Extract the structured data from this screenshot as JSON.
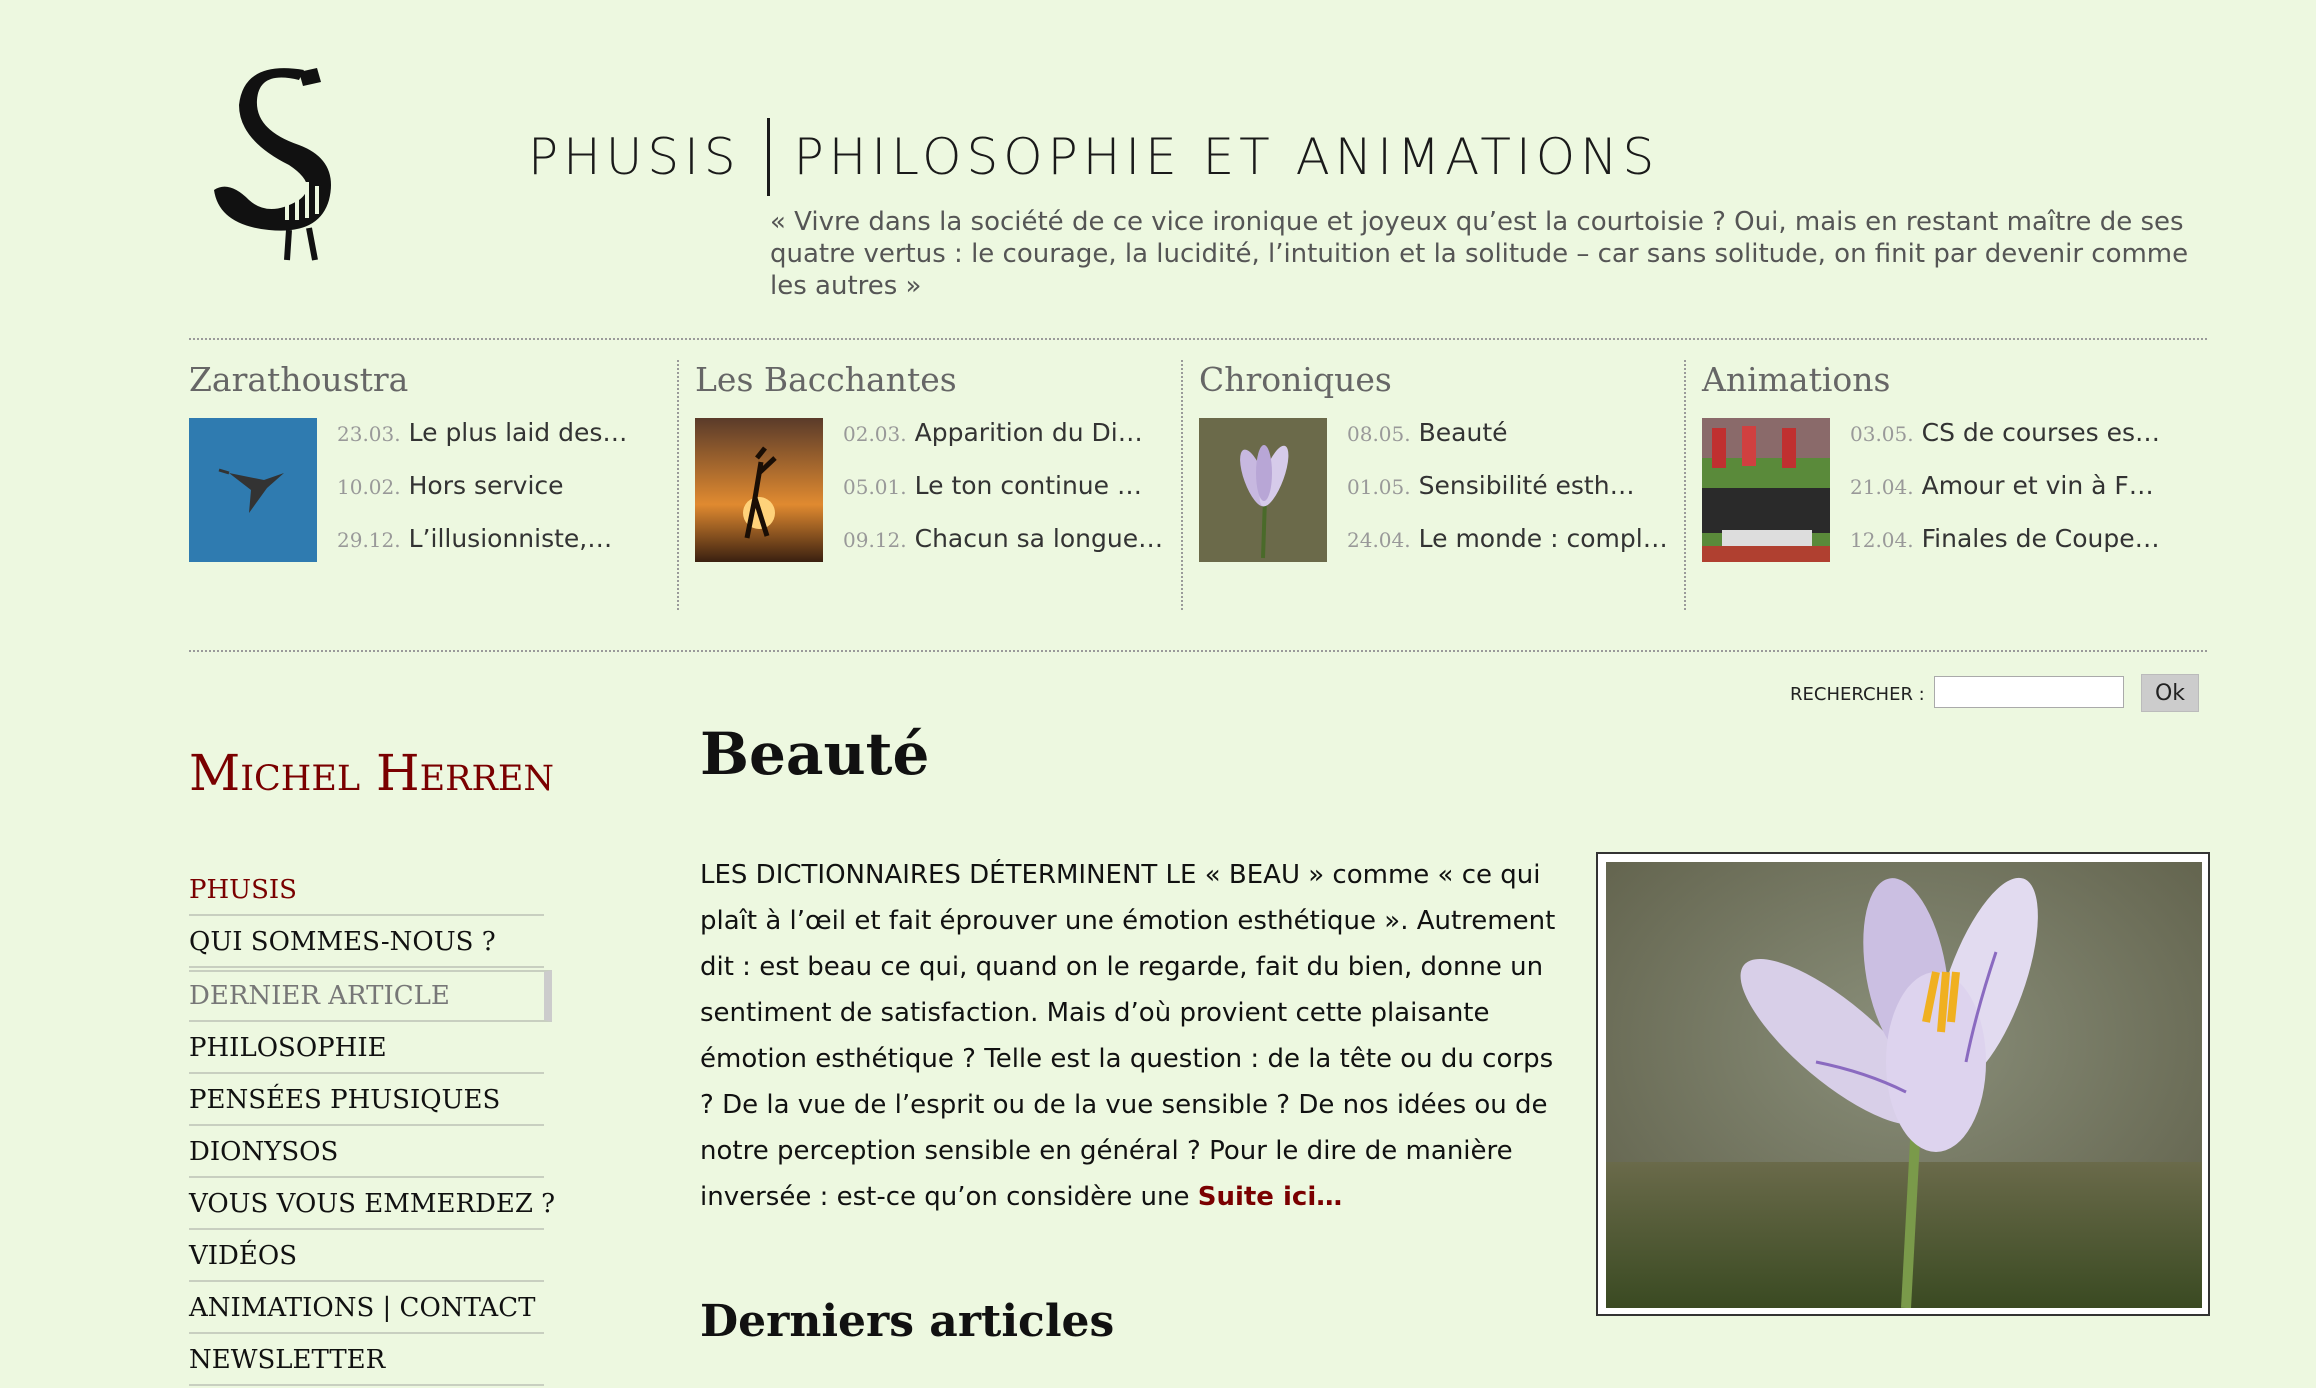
{
  "header": {
    "title_left": "PHUSIS",
    "title_right": "PHILOSOPHIE ET ANIMATIONS",
    "quote": "« Vivre dans la société de ce vice ironique et joyeux qu’est la courtoisie ? Oui, mais en restant maître de ses quatre vertus : le courage, la lucidité, l’intuition et la solitude – car sans solitude, on finit par devenir comme les autres »"
  },
  "columns": [
    {
      "title": "Zarathoustra",
      "thumb": "heron-in-flight",
      "items": [
        {
          "date": "23.03.",
          "title": "Le plus laid des…"
        },
        {
          "date": "10.02.",
          "title": "Hors service"
        },
        {
          "date": "29.12.",
          "title": "L’illusionniste,…"
        }
      ]
    },
    {
      "title": "Les Bacchantes",
      "thumb": "dancer-silhouette-sunset",
      "items": [
        {
          "date": "02.03.",
          "title": "Apparition du Di…"
        },
        {
          "date": "05.01.",
          "title": "Le ton continue …"
        },
        {
          "date": "09.12.",
          "title": "Chacun sa longue…"
        }
      ]
    },
    {
      "title": "Chroniques",
      "thumb": "crocus-flower",
      "items": [
        {
          "date": "08.05.",
          "title": "Beauté"
        },
        {
          "date": "01.05.",
          "title": "Sensibilité esth…"
        },
        {
          "date": "24.04.",
          "title": "Le monde : compl…"
        }
      ]
    },
    {
      "title": "Animations",
      "thumb": "athletes-podium",
      "items": [
        {
          "date": "03.05.",
          "title": "CS de courses es…"
        },
        {
          "date": "21.04.",
          "title": "Amour et vin à F…"
        },
        {
          "date": "12.04.",
          "title": "Finales de Coupe…"
        }
      ]
    }
  ],
  "search": {
    "label": "RECHERCHER :",
    "button": "Ok",
    "value": ""
  },
  "sidebar": {
    "author": "Michel Herren",
    "nav": [
      "PHUSIS",
      "QUI SOMMES-NOUS ?",
      "DERNIER ARTICLE",
      "PHILOSOPHIE",
      "PENSÉES PHUSIQUES",
      "DIONYSOS",
      "VOUS VOUS EMMERDEZ ?",
      "VIDÉOS",
      "ANIMATIONS | CONTACT",
      "NEWSLETTER"
    ]
  },
  "article": {
    "title": "Beauté",
    "body": "LES DICTIONNAIRES DÉTERMINENT LE « BEAU » comme « ce qui plaît à l’œil et fait éprouver une émotion esthétique ». Autrement dit : est beau ce qui, quand on le regarde, fait du bien, donne un sentiment de satisfaction. Mais d’où provient cette plaisante émotion esthétique ? Telle est la question : de la tête ou du corps ? De la vue de l’esprit ou de la vue sensible ? De nos idées ou de notre perception sensible en général ? Pour le dire de manière inversée : est-ce qu’on considère une ",
    "more": "Suite ici…",
    "image": "crocus-flower"
  },
  "latest": {
    "title": "Derniers articles"
  }
}
